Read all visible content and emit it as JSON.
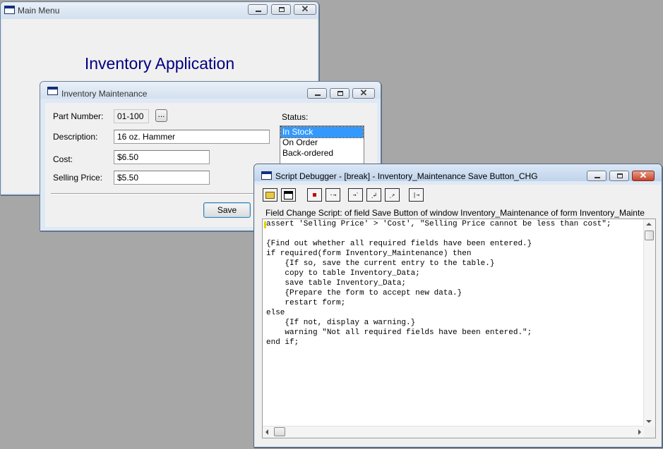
{
  "main_menu": {
    "title": "Main Menu",
    "heading": "Inventory Application"
  },
  "inventory_maintenance": {
    "title": "Inventory Maintenance",
    "part_number_label": "Part Number:",
    "part_number_value": "01-100",
    "lookup_label": "...",
    "description_label": "Description:",
    "description_value": "16 oz. Hammer",
    "cost_label": "Cost:",
    "cost_value": "$6.50",
    "selling_price_label": "Selling Price:",
    "selling_price_value": "$5.50",
    "status_label": "Status:",
    "status_options": [
      "In Stock",
      "On Order",
      "Back-ordered"
    ],
    "status_selected": "In Stock",
    "save_label": "Save"
  },
  "script_debugger": {
    "title": "Script Debugger - [break] - Inventory_Maintenance Save Button_CHG",
    "toolbar": [
      "open-script-icon",
      "edit-script-icon",
      "stop-icon",
      "step-icon",
      "step-into-icon",
      "step-over-icon",
      "step-out-icon",
      "continue-icon"
    ],
    "context": "Field Change Script: of field Save Button of window Inventory_Maintenance of form Inventory_Mainte",
    "code_lines": [
      "assert 'Selling Price' > 'Cost', \"Selling Price cannot be less than cost\";",
      "",
      "{Find out whether all required fields have been entered.}",
      "if required(form Inventory_Maintenance) then",
      "    {If so, save the current entry to the table.}",
      "    copy to table Inventory_Data;",
      "    save table Inventory_Data;",
      "    {Prepare the form to accept new data.}",
      "    restart form;",
      "else",
      "    {If not, display a warning.}",
      "    warning \"Not all required fields have been entered.\";",
      "end if;"
    ]
  }
}
